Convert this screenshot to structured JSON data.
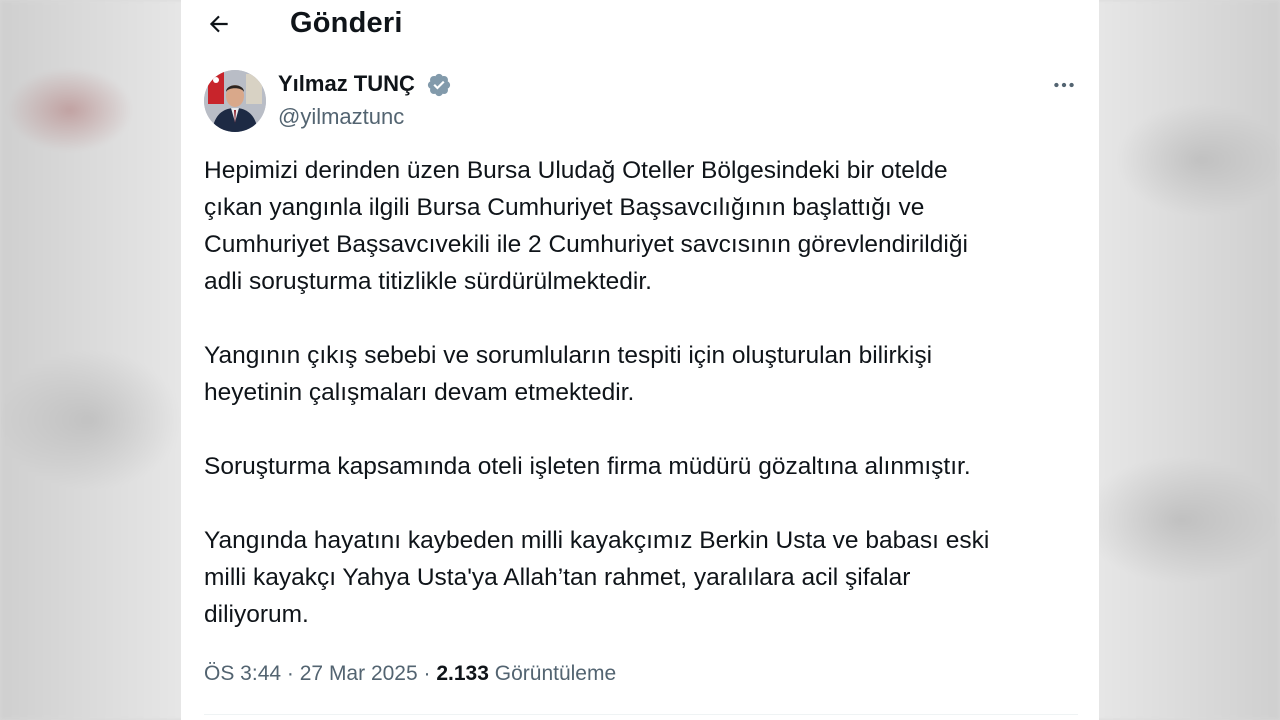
{
  "header": {
    "title": "Gönderi",
    "back_icon": "arrow-left-icon"
  },
  "author": {
    "name": "Yılmaz TUNÇ",
    "handle": "@yilmaztunc",
    "verified": true,
    "verified_color": "#829aab",
    "avatar_icon": "profile-photo"
  },
  "more_icon": "more-horizontal-icon",
  "tweet": {
    "paragraphs": [
      "Hepimizi derinden üzen Bursa Uludağ Oteller Bölgesindeki bir otelde\nçıkan yangınla ilgili Bursa Cumhuriyet Başsavcılığının başlattığı ve\nCumhuriyet Başsavcıvekili ile 2 Cumhuriyet savcısının görevlendirildiği\nadli soruşturma titizlikle sürdürülmektedir.",
      "Yangının çıkış sebebi ve sorumluların tespiti için oluşturulan bilirkişi\nheyetinin çalışmaları devam etmektedir.",
      "Soruşturma kapsamında oteli işleten firma müdürü gözaltına alınmıştır.",
      "Yangında hayatını kaybeden milli kayakçımız Berkin Usta ve babası eski\nmilli kayakçı Yahya Usta'ya Allah’tan rahmet, yaralılara acil şifalar\ndiliyorum."
    ]
  },
  "meta": {
    "time": "ÖS 3:44",
    "separator": "·",
    "date": "27 Mar 2025",
    "views_count": "2.133",
    "views_label": "Görüntüleme"
  },
  "colors": {
    "text_primary": "#0f1419",
    "text_secondary": "#536471",
    "background": "#ffffff"
  }
}
